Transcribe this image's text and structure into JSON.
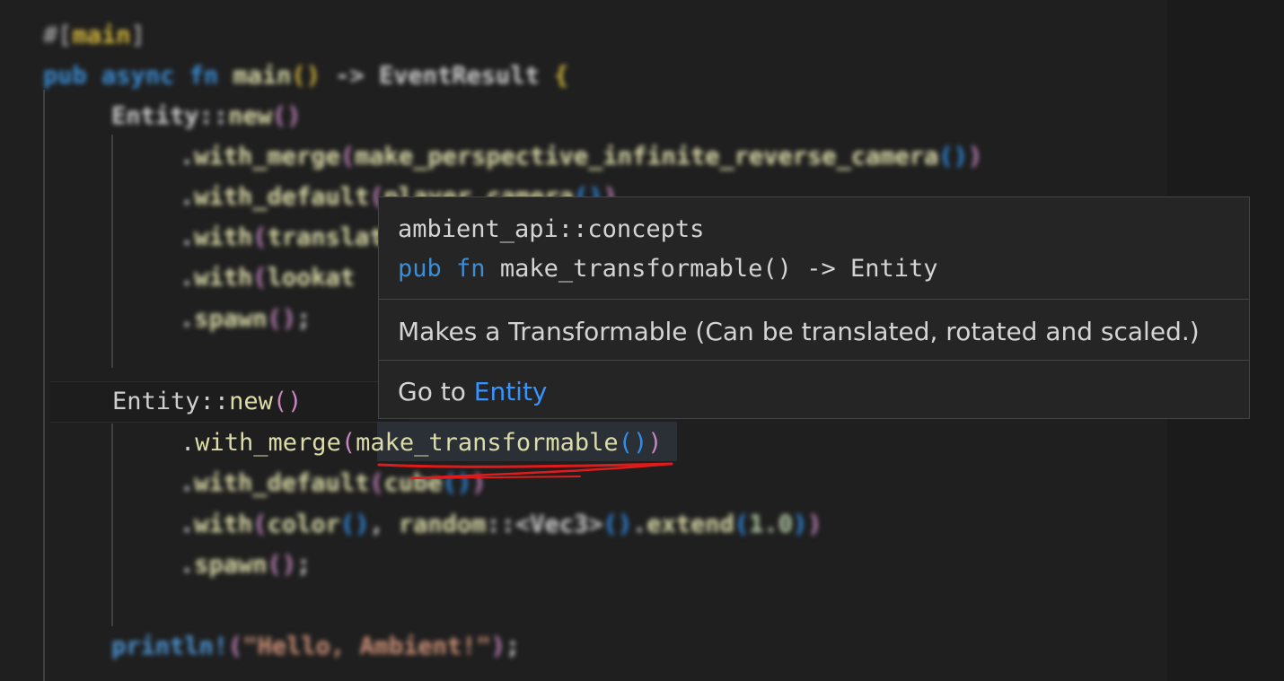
{
  "editor": {
    "lines": [
      {
        "id": "l1",
        "tokens": [
          [
            "#[",
            "attr"
          ],
          [
            "main",
            "p1"
          ],
          [
            "]",
            "attr"
          ]
        ]
      },
      {
        "id": "l2",
        "tokens": [
          [
            "pub",
            "kw"
          ],
          [
            " ",
            ""
          ],
          [
            "async",
            "kw"
          ],
          [
            " ",
            ""
          ],
          [
            "fn",
            "kw"
          ],
          [
            " ",
            ""
          ],
          [
            "main",
            "fn"
          ],
          [
            "()",
            "p1"
          ],
          [
            " -> ",
            ""
          ],
          [
            "EventResult",
            "ty"
          ],
          [
            " ",
            ""
          ],
          [
            "{",
            "p1"
          ]
        ]
      },
      {
        "id": "l3",
        "tokens": [
          [
            "Entity",
            "ty"
          ],
          [
            "::",
            ""
          ],
          [
            "new",
            "fn"
          ],
          [
            "()",
            "p2"
          ]
        ]
      },
      {
        "id": "l4",
        "tokens": [
          [
            ".",
            ""
          ],
          [
            "with_merge",
            "fn"
          ],
          [
            "(",
            "p2"
          ],
          [
            "make_perspective_infinite_reverse_camera",
            "fn"
          ],
          [
            "()",
            "p3"
          ],
          [
            ")",
            "p2"
          ]
        ]
      },
      {
        "id": "l5",
        "tokens": [
          [
            ".",
            ""
          ],
          [
            "with_default",
            "fn"
          ],
          [
            "(",
            "p2"
          ],
          [
            "player_camera",
            "fn"
          ],
          [
            "()",
            "p3"
          ],
          [
            ")",
            "p2"
          ]
        ]
      },
      {
        "id": "l6",
        "tokens": [
          [
            ".",
            ""
          ],
          [
            "with",
            "fn"
          ],
          [
            "(",
            "p2"
          ],
          [
            "translation",
            "fn"
          ]
        ]
      },
      {
        "id": "l7",
        "tokens": [
          [
            ".",
            ""
          ],
          [
            "with",
            "fn"
          ],
          [
            "(",
            "p2"
          ],
          [
            "lookat",
            "fn"
          ]
        ]
      },
      {
        "id": "l8",
        "tokens": [
          [
            ".",
            ""
          ],
          [
            "spawn",
            "fn"
          ],
          [
            "()",
            "p2"
          ],
          [
            ";",
            ""
          ]
        ]
      },
      {
        "id": "l10",
        "tokens": [
          [
            "Entity",
            "ty"
          ],
          [
            "::",
            ""
          ],
          [
            "new",
            "fn"
          ],
          [
            "()",
            "p2"
          ]
        ]
      },
      {
        "id": "l11",
        "tokens": [
          [
            ".",
            ""
          ],
          [
            "with_merge",
            "fn"
          ],
          [
            "(",
            "p2"
          ],
          [
            "make_transformable",
            "fn"
          ],
          [
            "()",
            "p3"
          ],
          [
            ")",
            "p2"
          ]
        ]
      },
      {
        "id": "l12",
        "tokens": [
          [
            ".",
            ""
          ],
          [
            "with_default",
            "fn"
          ],
          [
            "(",
            "p2"
          ],
          [
            "cube",
            "fn"
          ],
          [
            "()",
            "p3"
          ],
          [
            ")",
            "p2"
          ]
        ]
      },
      {
        "id": "l13",
        "tokens": [
          [
            ".",
            ""
          ],
          [
            "with",
            "fn"
          ],
          [
            "(",
            "p2"
          ],
          [
            "color",
            "fn"
          ],
          [
            "()",
            "p3"
          ],
          [
            ", ",
            ""
          ],
          [
            "random",
            "fn"
          ],
          [
            "::<",
            ""
          ],
          [
            "Vec3",
            "ty"
          ],
          [
            ">",
            ""
          ],
          [
            "()",
            "p3"
          ],
          [
            ".",
            ""
          ],
          [
            "extend",
            "fn"
          ],
          [
            "(",
            "p3"
          ],
          [
            "1.0",
            "num"
          ],
          [
            ")",
            "p3"
          ],
          [
            ")",
            "p2"
          ]
        ]
      },
      {
        "id": "l14",
        "tokens": [
          [
            ".",
            ""
          ],
          [
            "spawn",
            "fn"
          ],
          [
            "()",
            "p2"
          ],
          [
            ";",
            ""
          ]
        ]
      },
      {
        "id": "l16",
        "tokens": [
          [
            "println!",
            "mac"
          ],
          [
            "(",
            "p2"
          ],
          [
            "\"Hello, Ambient!\"",
            "str"
          ],
          [
            ")",
            "p2"
          ],
          [
            ";",
            ""
          ]
        ]
      }
    ]
  },
  "hover": {
    "module_path": "ambient_api::concepts",
    "sig_pub": "pub",
    "sig_fn": "fn",
    "sig_rest": "make_transformable() -> Entity",
    "description": "Makes a Transformable (Can be translated, rotated and scaled.)",
    "goto_prefix": "Go to",
    "goto_link": "Entity"
  },
  "colors": {
    "keyword": "#3b8ed6",
    "link": "#3794ff",
    "squiggle": "#e01b1b"
  },
  "icons": [
    "squiggle-annotation"
  ]
}
